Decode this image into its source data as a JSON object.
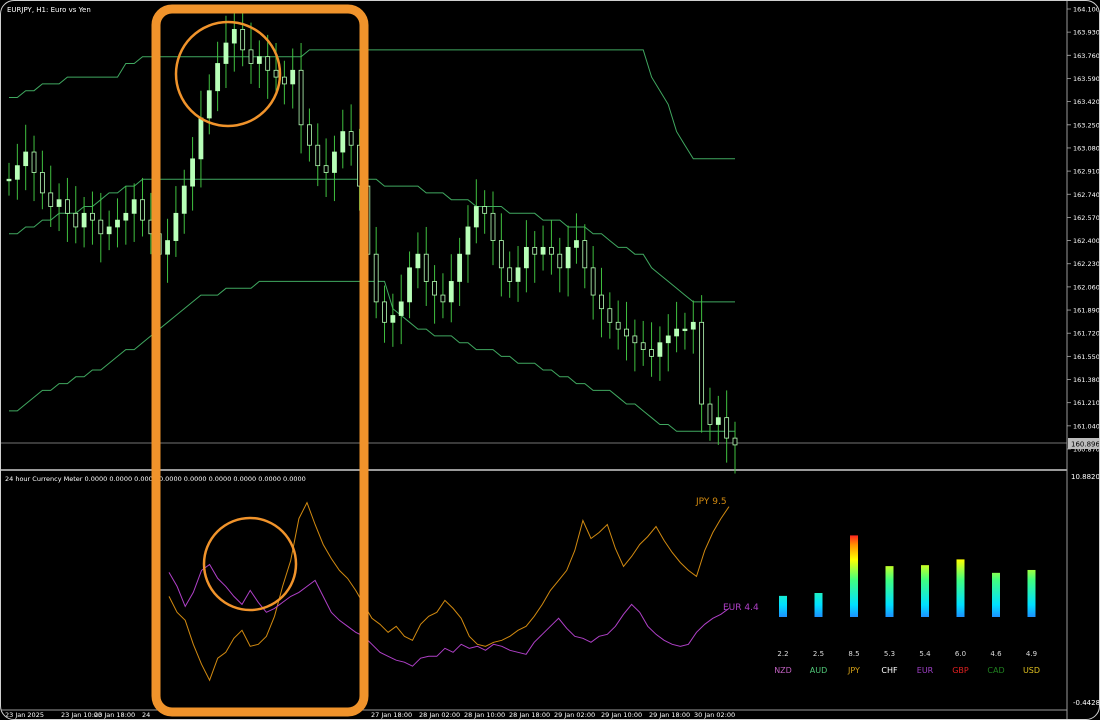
{
  "main_chart": {
    "title": "EURJPY, H1: Euro vs Yen",
    "price_ticks": [
      "164.100",
      "163.930",
      "163.760",
      "163.590",
      "163.420",
      "163.250",
      "163.080",
      "162.910",
      "162.740",
      "162.570",
      "162.400",
      "162.230",
      "162.060",
      "161.890",
      "161.720",
      "161.550",
      "161.380",
      "161.210",
      "161.040",
      "160.870"
    ],
    "current_price": "160.896",
    "ylim": [
      160.87,
      164.1
    ]
  },
  "indicator": {
    "title": "24 hour Currency Meter 0.0000 0.0000 0.0000 0.0000 0.0000 0.0000 0.0000 0.0000 0.0000",
    "ylim_labels": [
      "10.8820",
      "-0.4428"
    ],
    "line_labels": {
      "jpy": "JPY 9.5",
      "eur": "EUR 4.4"
    }
  },
  "x_ticks": [
    "23 Jan 2025",
    "23 Jan 10:00",
    "23 Jan 18:00",
    "24",
    "27 Jan 18:00",
    "28 Jan 02:00",
    "28 Jan 10:00",
    "28 Jan 18:00",
    "29 Jan 02:00",
    "29 Jan 10:00",
    "29 Jan 18:00",
    "30 Jan 02:00"
  ],
  "chart_data": [
    {
      "type": "candlestick",
      "title": "EURJPY, H1: Euro vs Yen",
      "ylim": [
        160.87,
        164.1
      ],
      "close": [
        162.85,
        162.95,
        163.05,
        162.9,
        162.75,
        162.65,
        162.7,
        162.6,
        162.5,
        162.6,
        162.55,
        162.45,
        162.5,
        162.55,
        162.6,
        162.7,
        162.55,
        162.45,
        162.3,
        162.4,
        162.6,
        162.8,
        163.0,
        163.3,
        163.5,
        163.7,
        163.85,
        163.95,
        163.8,
        163.7,
        163.75,
        163.65,
        163.6,
        163.55,
        163.65,
        163.25,
        163.1,
        162.95,
        162.9,
        163.05,
        163.2,
        163.1,
        162.8,
        162.3,
        161.95,
        161.8,
        161.85,
        161.95,
        162.2,
        162.3,
        162.1,
        162.0,
        161.95,
        162.1,
        162.3,
        162.5,
        162.65,
        162.6,
        162.4,
        162.2,
        162.1,
        162.2,
        162.35,
        162.3,
        162.35,
        162.3,
        162.2,
        162.35,
        162.4,
        162.2,
        162.0,
        161.9,
        161.8,
        161.75,
        161.7,
        161.65,
        161.6,
        161.55,
        161.65,
        161.7,
        161.75,
        161.75,
        161.8,
        161.2,
        161.05,
        161.1,
        160.95,
        160.9
      ],
      "upper_band": [
        163.45,
        163.45,
        163.5,
        163.5,
        163.55,
        163.55,
        163.55,
        163.6,
        163.6,
        163.6,
        163.6,
        163.6,
        163.6,
        163.6,
        163.7,
        163.7,
        163.75,
        163.75,
        163.75,
        163.75,
        163.75,
        163.75,
        163.75,
        163.75,
        163.75,
        163.75,
        163.75,
        163.75,
        163.75,
        163.75,
        163.75,
        163.75,
        163.75,
        163.75,
        163.75,
        163.75,
        163.8,
        163.8,
        163.8,
        163.8,
        163.8,
        163.8,
        163.8,
        163.8,
        163.8,
        163.8,
        163.8,
        163.8,
        163.8,
        163.8,
        163.8,
        163.8,
        163.8,
        163.8,
        163.8,
        163.8,
        163.8,
        163.8,
        163.8,
        163.8,
        163.8,
        163.8,
        163.8,
        163.8,
        163.8,
        163.8,
        163.8,
        163.8,
        163.8,
        163.8,
        163.8,
        163.8,
        163.8,
        163.8,
        163.8,
        163.8,
        163.8,
        163.6,
        163.5,
        163.4,
        163.2,
        163.1,
        163.0,
        163.0,
        163.0,
        163.0,
        163.0,
        163.0
      ],
      "middle_band": [
        162.45,
        162.45,
        162.5,
        162.5,
        162.55,
        162.55,
        162.6,
        162.6,
        162.6,
        162.65,
        162.65,
        162.7,
        162.75,
        162.75,
        162.8,
        162.8,
        162.85,
        162.85,
        162.85,
        162.85,
        162.85,
        162.85,
        162.85,
        162.85,
        162.85,
        162.85,
        162.85,
        162.85,
        162.85,
        162.85,
        162.85,
        162.85,
        162.85,
        162.85,
        162.85,
        162.85,
        162.85,
        162.85,
        162.85,
        162.85,
        162.85,
        162.85,
        162.85,
        162.85,
        162.85,
        162.8,
        162.8,
        162.8,
        162.8,
        162.8,
        162.75,
        162.75,
        162.75,
        162.7,
        162.7,
        162.7,
        162.65,
        162.65,
        162.65,
        162.65,
        162.6,
        162.6,
        162.6,
        162.6,
        162.55,
        162.55,
        162.55,
        162.5,
        162.5,
        162.5,
        162.45,
        162.45,
        162.4,
        162.35,
        162.35,
        162.3,
        162.3,
        162.2,
        162.15,
        162.1,
        162.05,
        162.0,
        161.95,
        161.95,
        161.95,
        161.95,
        161.95,
        161.95
      ],
      "lower_band": [
        161.15,
        161.15,
        161.2,
        161.25,
        161.3,
        161.3,
        161.35,
        161.35,
        161.4,
        161.4,
        161.45,
        161.45,
        161.5,
        161.55,
        161.6,
        161.6,
        161.65,
        161.7,
        161.75,
        161.8,
        161.85,
        161.9,
        161.95,
        162.0,
        162.0,
        162.0,
        162.05,
        162.05,
        162.05,
        162.05,
        162.1,
        162.1,
        162.1,
        162.1,
        162.1,
        162.1,
        162.1,
        162.1,
        162.1,
        162.1,
        162.1,
        162.1,
        162.1,
        162.1,
        162.1,
        162.1,
        161.9,
        161.85,
        161.8,
        161.75,
        161.75,
        161.7,
        161.7,
        161.7,
        161.65,
        161.65,
        161.6,
        161.6,
        161.6,
        161.55,
        161.55,
        161.5,
        161.5,
        161.5,
        161.45,
        161.45,
        161.4,
        161.4,
        161.35,
        161.35,
        161.3,
        161.3,
        161.3,
        161.25,
        161.2,
        161.2,
        161.15,
        161.1,
        161.05,
        161.05,
        161.0,
        161.0,
        161.0,
        161.0,
        161.0,
        161.0,
        161.0,
        161.0
      ]
    },
    {
      "type": "line",
      "title": "24 hour Currency Meter",
      "ylim": [
        -0.4428,
        10.882
      ],
      "series": [
        {
          "name": "JPY 9.5",
          "color": "#d28a10",
          "values": [
            5.0,
            4.2,
            3.8,
            2.6,
            1.6,
            0.8,
            1.9,
            2.2,
            2.9,
            3.3,
            2.5,
            2.6,
            3.0,
            4.0,
            5.5,
            6.8,
            8.9,
            9.7,
            8.6,
            7.6,
            6.9,
            6.3,
            5.9,
            5.3,
            4.6,
            3.9,
            3.6,
            3.2,
            3.5,
            3.0,
            2.8,
            3.6,
            4.0,
            4.2,
            4.8,
            4.4,
            3.9,
            3.0,
            2.6,
            2.5,
            2.7,
            2.8,
            3.0,
            3.3,
            3.5,
            4.0,
            4.6,
            5.3,
            5.8,
            6.3,
            7.3,
            8.8,
            7.9,
            8.2,
            8.6,
            7.4,
            6.5,
            7.0,
            7.6,
            8.0,
            8.5,
            7.8,
            7.2,
            6.7,
            6.3,
            6.0,
            7.3,
            8.2,
            8.9,
            9.5
          ]
        },
        {
          "name": "EUR 4.4",
          "color": "#b040c8",
          "values": [
            6.2,
            5.5,
            4.5,
            5.2,
            6.3,
            6.6,
            5.9,
            5.5,
            5.0,
            4.6,
            5.3,
            4.7,
            4.2,
            4.4,
            4.7,
            5.0,
            5.2,
            5.5,
            5.8,
            5.0,
            4.2,
            3.8,
            3.5,
            3.2,
            3.0,
            2.6,
            2.2,
            2.0,
            1.8,
            1.7,
            1.5,
            1.9,
            2.0,
            2.0,
            2.4,
            2.2,
            2.6,
            2.4,
            2.5,
            2.3,
            2.6,
            2.5,
            2.3,
            2.2,
            2.1,
            2.7,
            3.1,
            3.5,
            3.9,
            3.4,
            3.0,
            2.9,
            2.7,
            3.0,
            3.1,
            3.5,
            4.1,
            4.6,
            4.2,
            3.5,
            3.1,
            2.8,
            2.6,
            2.5,
            2.6,
            3.2,
            3.6,
            3.9,
            4.1,
            4.4
          ]
        }
      ]
    },
    {
      "type": "bar",
      "title": "",
      "categories": [
        "NZD",
        "AUD",
        "JPY",
        "CHF",
        "EUR",
        "GBP",
        "CAD",
        "USD"
      ],
      "values": [
        2.2,
        2.5,
        8.5,
        5.3,
        5.4,
        6.0,
        4.6,
        4.9
      ],
      "value_labels": [
        "2.2",
        "2.5",
        "8.5",
        "5.3",
        "5.4",
        "6.0",
        "4.6",
        "4.9"
      ],
      "label_colors": [
        "#c060c0",
        "#50c878",
        "#d4a017",
        "#ffffff",
        "#a040c8",
        "#e02020",
        "#208020",
        "#e0c020"
      ]
    }
  ],
  "annotations": {
    "highlight_color": "#f0932b"
  },
  "colors": {
    "candle": "#b8ffb8",
    "wick": "#40c040",
    "band": "#40a860",
    "panel_line": "#888888"
  }
}
